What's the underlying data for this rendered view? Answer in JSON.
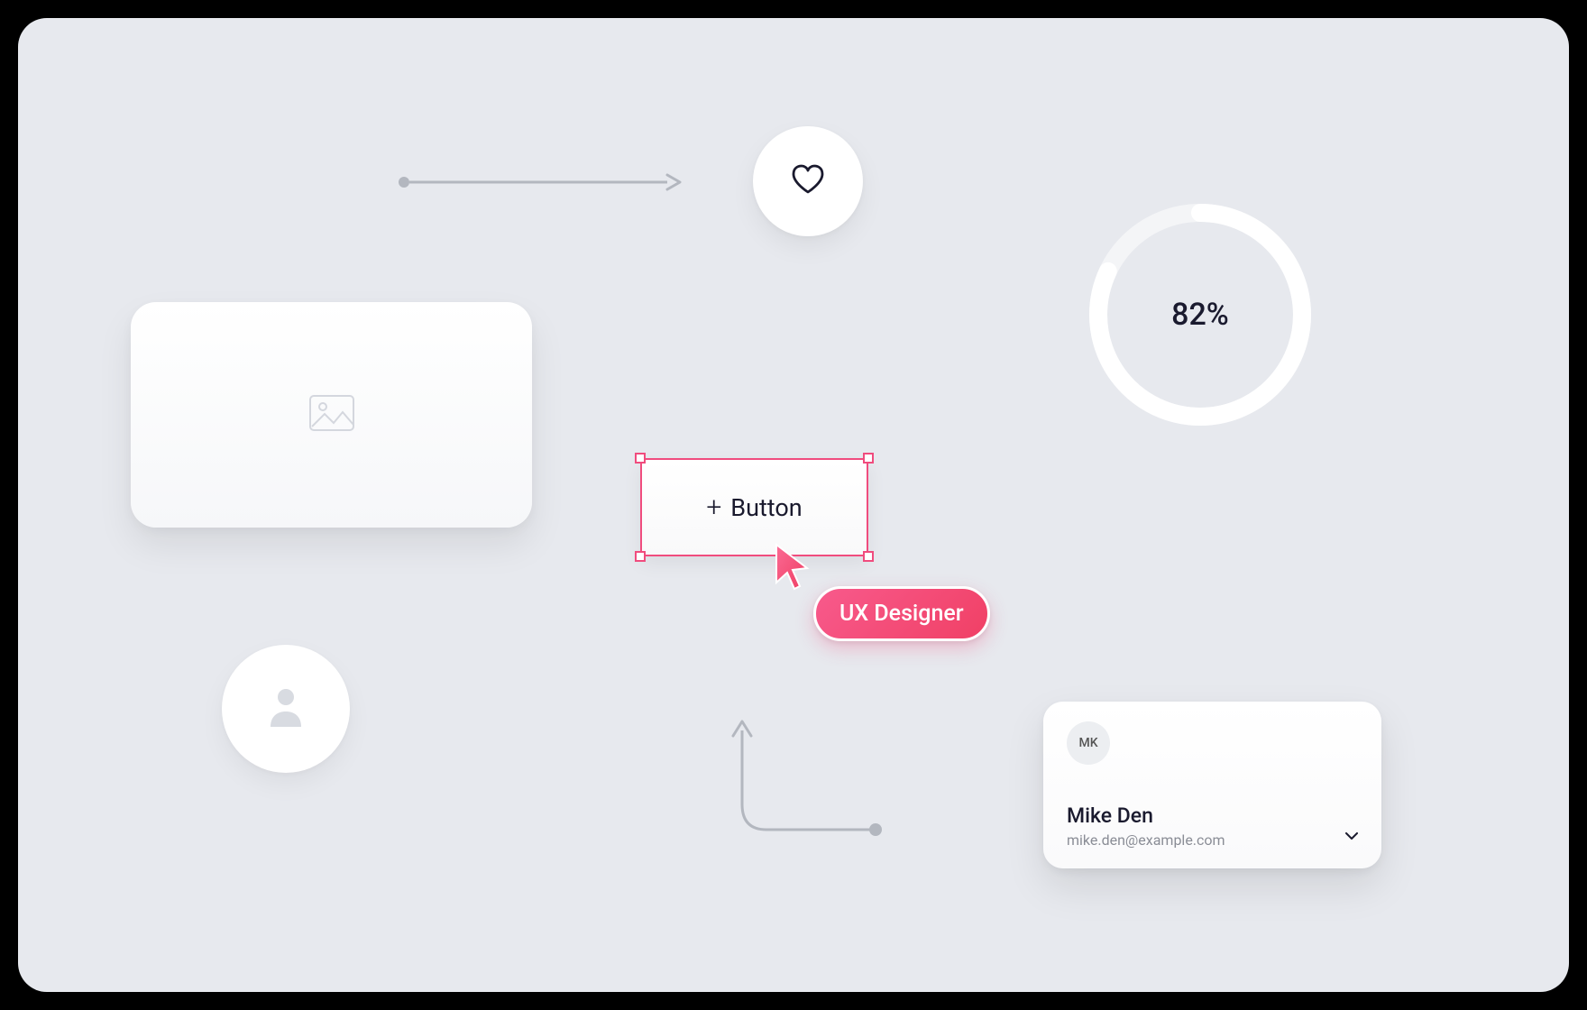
{
  "progress": {
    "percent": 82,
    "label": "82%"
  },
  "button": {
    "label": "Button",
    "icon": "plus"
  },
  "cursor": {
    "label": "UX Designer"
  },
  "user": {
    "initials": "MK",
    "name": "Mike Den",
    "email": "mike.den@example.com"
  },
  "colors": {
    "accent": "#f04c7e",
    "ring_track": "#ffffff",
    "text_dark": "#1a1a2e"
  }
}
